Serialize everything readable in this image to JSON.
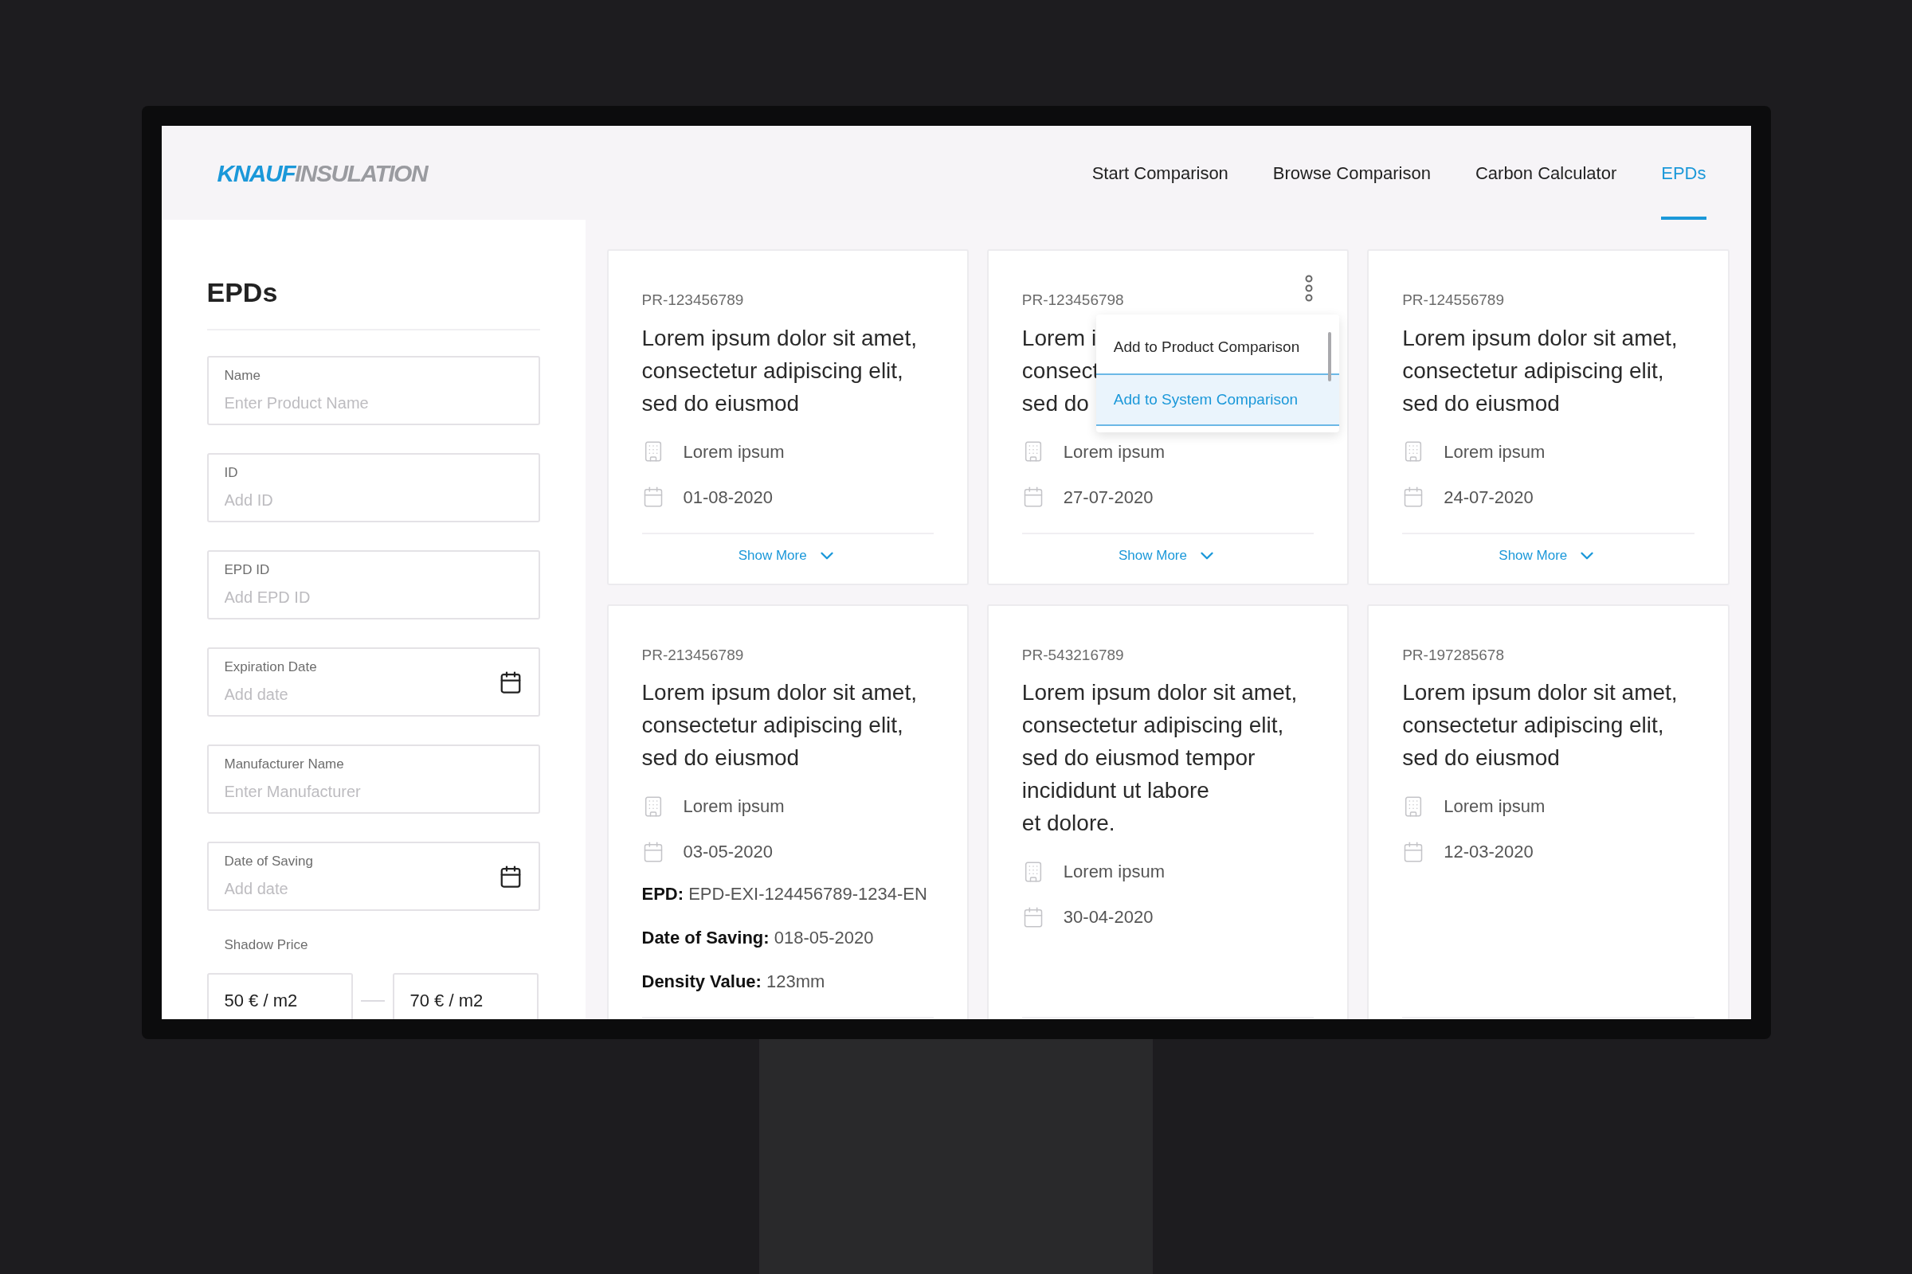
{
  "header": {
    "logo": {
      "brand": "KNAUF",
      "product": "INSULATION"
    },
    "nav": [
      {
        "label": "Start Comparison",
        "selected": false
      },
      {
        "label": "Browse Comparison",
        "selected": false
      },
      {
        "label": "Carbon Calculator",
        "selected": false
      },
      {
        "label": "EPDs",
        "selected": true
      }
    ]
  },
  "sidebar": {
    "title": "EPDs",
    "fields": [
      {
        "kind": "text",
        "label": "Name",
        "placeholder": "Enter Product Name"
      },
      {
        "kind": "text",
        "label": "ID",
        "placeholder": "Add ID"
      },
      {
        "kind": "text",
        "label": "EPD ID",
        "placeholder": "Add EPD ID"
      },
      {
        "kind": "date",
        "label": "Expiration Date",
        "placeholder": "Add date"
      },
      {
        "kind": "text",
        "label": "Manufacturer Name",
        "placeholder": "Enter Manufacturer"
      },
      {
        "kind": "date",
        "label": "Date of Saving",
        "placeholder": "Add date"
      }
    ],
    "shadow_price": {
      "label": "Shadow Price",
      "min": "50 € / m2",
      "max": "70 € / m2"
    }
  },
  "cards": [
    {
      "id": "PR-123456789",
      "title_lines": [
        "Lorem ipsum dolor sit amet,",
        "consectetur adipiscing elit,",
        "sed do eiusmod"
      ],
      "manufacturer": "Lorem ipsum",
      "date": "01-08-2020",
      "show_more": "Show More"
    },
    {
      "id": "PR-123456798",
      "title_lines": [
        "Lorem i",
        "consect",
        "sed do"
      ],
      "manufacturer": "Lorem ipsum",
      "date": "27-07-2020",
      "show_more": "Show More",
      "menu": [
        {
          "label": "Add to Product Comparison",
          "selected": false
        },
        {
          "label": "Add to System Comparison",
          "selected": true
        }
      ]
    },
    {
      "id": "PR-124556789",
      "title_lines": [
        "Lorem ipsum dolor sit amet,",
        "consectetur adipiscing elit,",
        "sed do eiusmod"
      ],
      "manufacturer": "Lorem ipsum",
      "date": "24-07-2020",
      "show_more": "Show More"
    },
    {
      "id": "PR-213456789",
      "title_lines": [
        "Lorem ipsum dolor sit amet,",
        "consectetur adipiscing elit,",
        "sed do eiusmod"
      ],
      "manufacturer": "Lorem ipsum",
      "date": "03-05-2020",
      "details": [
        {
          "label": "EPD:",
          "value": "EPD-EXI-124456789-1234-EN"
        },
        {
          "label": "Date of Saving:",
          "value": "018-05-2020"
        },
        {
          "label": "Density Value:",
          "value": "123mm"
        }
      ]
    },
    {
      "id": "PR-543216789",
      "title_lines": [
        "Lorem ipsum dolor sit amet,",
        "consectetur adipiscing elit,",
        "sed do eiusmod tempor",
        "incididunt ut labore",
        "et dolore."
      ],
      "manufacturer": "Lorem ipsum",
      "date": "30-04-2020"
    },
    {
      "id": "PR-197285678",
      "title_lines": [
        "Lorem ipsum dolor sit amet,",
        "consectetur adipiscing elit,",
        "sed do eiusmod"
      ],
      "manufacturer": "Lorem ipsum",
      "date": "12-03-2020"
    }
  ]
}
